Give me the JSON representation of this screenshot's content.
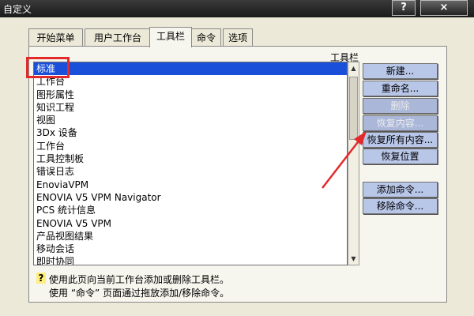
{
  "window": {
    "title": "自定义",
    "help_glyph": "?",
    "close_glyph": "×"
  },
  "tabs": [
    {
      "label": "开始菜单"
    },
    {
      "label": "用户工作台"
    },
    {
      "label": "工具栏",
      "active": true
    },
    {
      "label": "命令"
    },
    {
      "label": "选项"
    }
  ],
  "toolbars": {
    "header": "工具栏",
    "items": [
      {
        "label": "标准",
        "selected": true
      },
      {
        "label": "工作台"
      },
      {
        "label": "图形属性"
      },
      {
        "label": "知识工程"
      },
      {
        "label": "视图"
      },
      {
        "label": "3Dx 设备"
      },
      {
        "label": "工作台"
      },
      {
        "label": "工具控制板"
      },
      {
        "label": "错误日志"
      },
      {
        "label": "EnoviaVPM"
      },
      {
        "label": "ENOVIA V5 VPM Navigator"
      },
      {
        "label": "PCS 统计信息"
      },
      {
        "label": "ENOVIA V5 VPM"
      },
      {
        "label": "产品视图结果"
      },
      {
        "label": "移动会话"
      },
      {
        "label": "即时协同"
      }
    ]
  },
  "buttons": {
    "new": "新建...",
    "rename": "重命名...",
    "delete": "删除",
    "restore_contents": "恢复内容...",
    "restore_all": "恢复所有内容...",
    "restore_position": "恢复位置",
    "add_commands": "添加命令...",
    "remove_commands": "移除命令..."
  },
  "help": {
    "icon": "?",
    "line1": "使用此页向当前工作台添加或删除工具栏。",
    "line2": "使用 “命令” 页面通过拖放添加/移除命令。"
  },
  "colors": {
    "selection": "#1a50d9",
    "annotation": "#e32a2a",
    "button": "#b8c6e8"
  }
}
